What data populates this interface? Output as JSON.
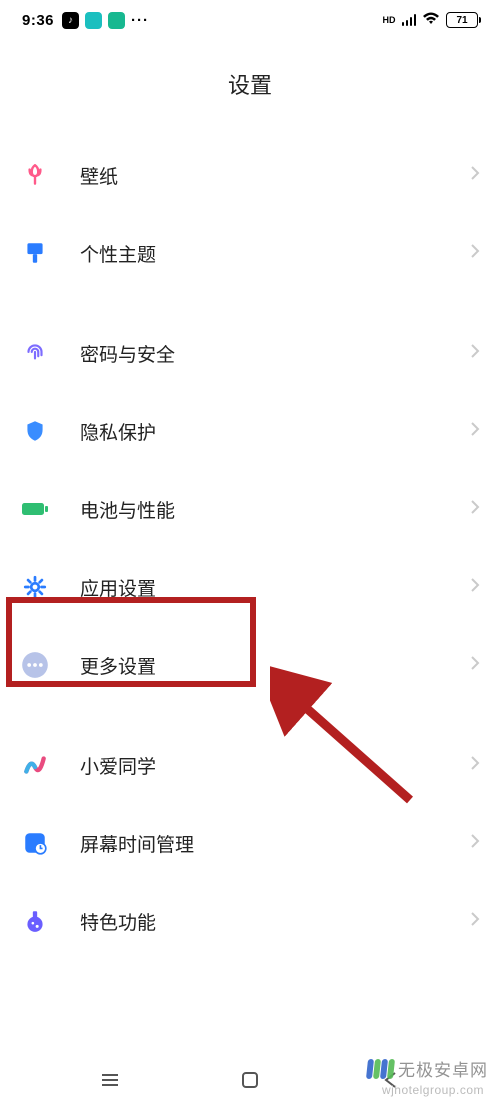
{
  "status": {
    "time": "9:36",
    "hd_label": "HD",
    "battery": "71"
  },
  "title": "设置",
  "groups": [
    {
      "items": [
        {
          "key": "wallpaper",
          "label": "壁纸",
          "icon": "tulip",
          "color": "#ff5a8a"
        },
        {
          "key": "theme",
          "label": "个性主题",
          "icon": "brush",
          "color": "#2a7cff"
        }
      ]
    },
    {
      "items": [
        {
          "key": "security",
          "label": "密码与安全",
          "icon": "fingerprint",
          "color": "#7d6cff"
        },
        {
          "key": "privacy",
          "label": "隐私保护",
          "icon": "shield",
          "color": "#3a8dff"
        },
        {
          "key": "battery",
          "label": "电池与性能",
          "icon": "battery",
          "color": "#2fbe72"
        },
        {
          "key": "apps",
          "label": "应用设置",
          "icon": "gear",
          "color": "#2a7cff"
        },
        {
          "key": "more",
          "label": "更多设置",
          "icon": "more",
          "color": "#b7c3e8"
        }
      ]
    },
    {
      "items": [
        {
          "key": "xiaoai",
          "label": "小爱同学",
          "icon": "xiaoai",
          "color": "multi"
        },
        {
          "key": "screentime",
          "label": "屏幕时间管理",
          "icon": "clock",
          "color": "#2a7cff"
        },
        {
          "key": "features",
          "label": "特色功能",
          "icon": "flask",
          "color": "#6a5eff"
        }
      ]
    }
  ],
  "watermark": {
    "text": "无极安卓网",
    "url": "wjhotelgroup.com"
  }
}
